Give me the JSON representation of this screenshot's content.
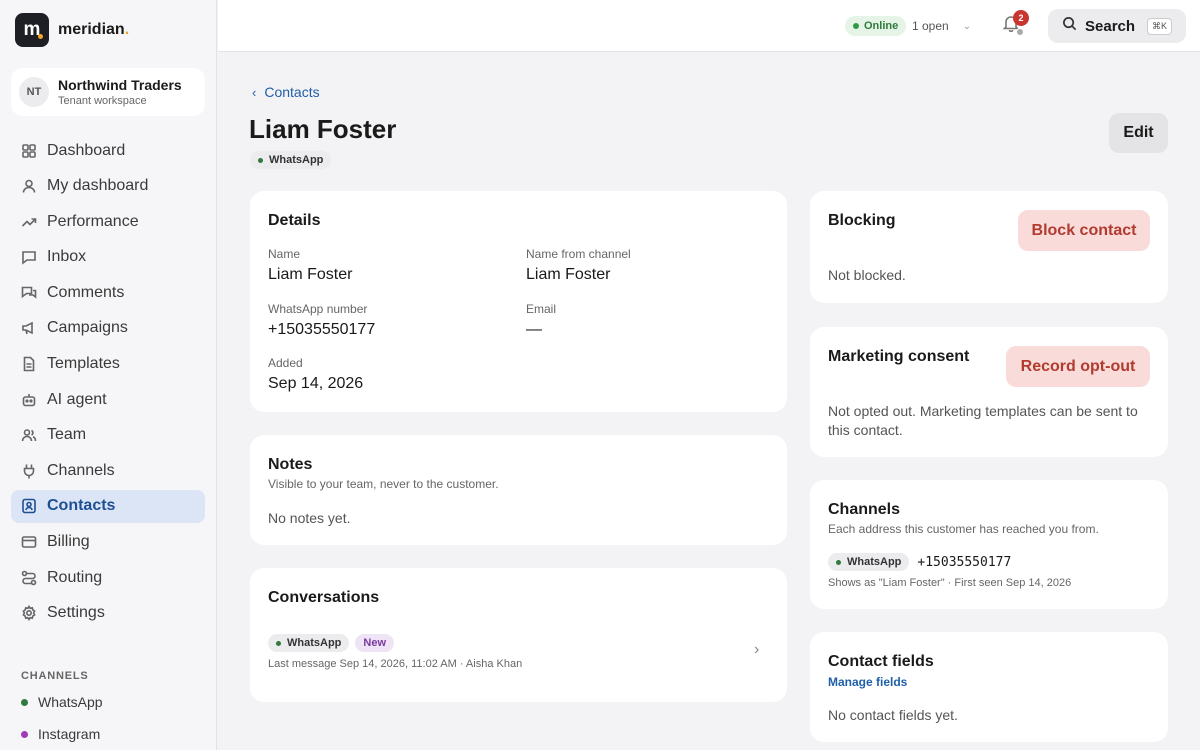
{
  "brand": {
    "name": "meridian",
    "mark": "m"
  },
  "tenant": {
    "initials": "NT",
    "name": "Northwind Traders",
    "subtitle": "Tenant workspace"
  },
  "nav": [
    {
      "label": "Dashboard",
      "icon": "grid-icon"
    },
    {
      "label": "My dashboard",
      "icon": "user-icon"
    },
    {
      "label": "Performance",
      "icon": "trend-icon"
    },
    {
      "label": "Inbox",
      "icon": "chat-icon"
    },
    {
      "label": "Comments",
      "icon": "comments-icon"
    },
    {
      "label": "Campaigns",
      "icon": "megaphone-icon"
    },
    {
      "label": "Templates",
      "icon": "file-icon"
    },
    {
      "label": "AI agent",
      "icon": "bot-icon"
    },
    {
      "label": "Team",
      "icon": "team-icon"
    },
    {
      "label": "Channels",
      "icon": "plug-icon"
    },
    {
      "label": "Contacts",
      "icon": "contact-icon",
      "active": true
    },
    {
      "label": "Billing",
      "icon": "card-icon"
    },
    {
      "label": "Routing",
      "icon": "routing-icon"
    },
    {
      "label": "Settings",
      "icon": "gear-icon"
    }
  ],
  "channels_section": {
    "heading": "CHANNELS",
    "items": [
      {
        "label": "WhatsApp",
        "color": "#2f7a3c"
      },
      {
        "label": "Instagram",
        "color": "#a23ab8"
      }
    ]
  },
  "topbar": {
    "status": "Online",
    "open": "1 open",
    "notifications": "2",
    "search_label": "Search",
    "search_shortcut": "⌘K"
  },
  "breadcrumb": {
    "label": "Contacts"
  },
  "contact": {
    "name": "Liam Foster",
    "channel": "WhatsApp",
    "edit_label": "Edit"
  },
  "details": {
    "title": "Details",
    "fields": {
      "name_label": "Name",
      "name_value": "Liam Foster",
      "channel_name_label": "Name from channel",
      "channel_name_value": "Liam Foster",
      "whatsapp_label": "WhatsApp number",
      "whatsapp_value": "+15035550177",
      "email_label": "Email",
      "email_value": "—",
      "added_label": "Added",
      "added_value": "Sep 14, 2026"
    }
  },
  "notes": {
    "title": "Notes",
    "subtitle": "Visible to your team, never to the customer.",
    "empty": "No notes yet."
  },
  "conversations": {
    "title": "Conversations",
    "items": [
      {
        "channel": "WhatsApp",
        "status": "New",
        "meta": "Last message Sep 14, 2026, 11:02 AM · Aisha Khan"
      }
    ]
  },
  "blocking": {
    "title": "Blocking",
    "button": "Block contact",
    "status": "Not blocked."
  },
  "consent": {
    "title": "Marketing consent",
    "button": "Record opt-out",
    "status": "Not opted out. Marketing templates can be sent to this contact."
  },
  "channels_card": {
    "title": "Channels",
    "subtitle": "Each address this customer has reached you from.",
    "items": [
      {
        "channel": "WhatsApp",
        "address": "+15035550177",
        "meta": "Shows as \"Liam Foster\" · First seen Sep 14, 2026"
      }
    ]
  },
  "contact_fields": {
    "title": "Contact fields",
    "link": "Manage fields",
    "empty": "No contact fields yet."
  },
  "colors": {
    "accent": "#1f5fa8",
    "active_bg": "#dbe5f6",
    "danger_bg": "#f9dcd9",
    "danger_text": "#b23a2e",
    "online": "#2f7a3c"
  }
}
